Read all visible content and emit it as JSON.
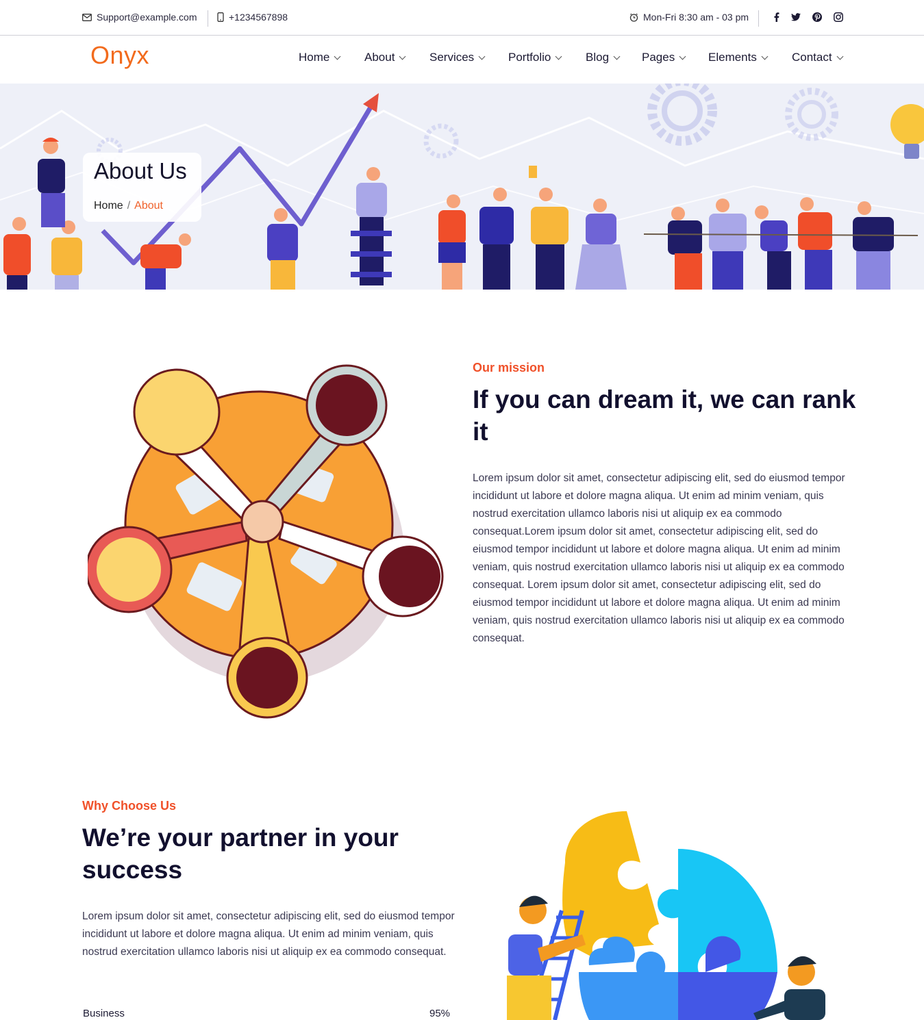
{
  "topbar": {
    "email": "Support@example.com",
    "phone": "+1234567898",
    "hours": "Mon-Fri 8:30 am - 03 pm",
    "socials": [
      "facebook-icon",
      "twitter-icon",
      "pinterest-icon",
      "instagram-icon"
    ]
  },
  "brand": {
    "logo": "Onyx",
    "accent": "#f26b1d"
  },
  "nav": {
    "items": [
      {
        "label": "Home"
      },
      {
        "label": "About"
      },
      {
        "label": "Services"
      },
      {
        "label": "Portfolio"
      },
      {
        "label": "Blog"
      },
      {
        "label": "Pages"
      },
      {
        "label": "Elements"
      },
      {
        "label": "Contact"
      }
    ]
  },
  "hero": {
    "title": "About Us",
    "breadcrumb": {
      "home": "Home",
      "separator": "/",
      "current": "About"
    }
  },
  "mission": {
    "eyebrow": "Our mission",
    "heading": "If you can dream it, we can rank it",
    "body": "Lorem ipsum dolor sit amet, consectetur adipiscing elit, sed do eiusmod tempor incididunt ut labore et dolore magna aliqua. Ut enim ad minim veniam, quis nostrud exercitation ullamco laboris nisi ut aliquip ex ea commodo consequat.Lorem ipsum dolor sit amet, consectetur adipiscing elit, sed do eiusmod tempor incididunt ut labore et dolore magna aliqua. Ut enim ad minim veniam, quis nostrud exercitation ullamco laboris nisi ut aliquip ex ea commodo consequat. Lorem ipsum dolor sit amet, consectetur adipiscing elit, sed do eiusmod tempor incididunt ut labore et dolore magna aliqua. Ut enim ad minim veniam, quis nostrud exercitation ullamco laboris nisi ut aliquip ex ea commodo consequat."
  },
  "why": {
    "eyebrow": "Why Choose Us",
    "heading": "We’re your partner in your success",
    "body": "Lorem ipsum dolor sit amet, consectetur adipiscing elit, sed do eiusmod tempor incididunt ut labore et dolore magna aliqua. Ut enim ad minim veniam, quis nostrud exercitation ullamco laboris nisi ut aliquip ex ea commodo consequat.",
    "skills": [
      {
        "label": "Business",
        "value": "95%"
      }
    ]
  },
  "colors": {
    "accent": "#f0512a",
    "heading": "#12102e",
    "orange": "#f8a035",
    "cyan": "#18c6f5",
    "blue": "#3b7ff0",
    "yellow": "#f7bc16"
  }
}
